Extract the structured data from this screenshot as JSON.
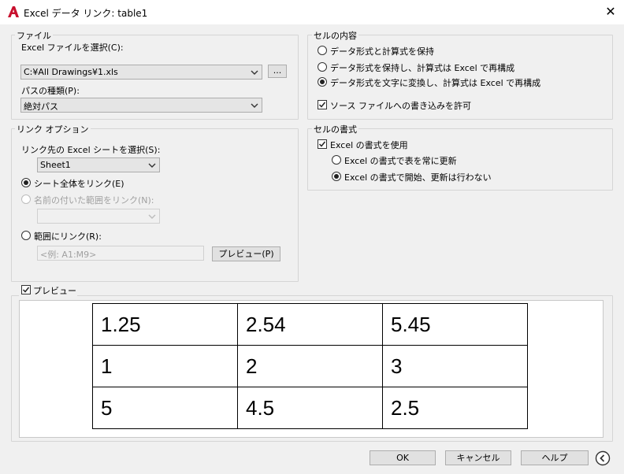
{
  "window": {
    "title": "Excel データ リンク: table1",
    "close": "✕"
  },
  "file_group": {
    "label": "ファイル",
    "select_label": "Excel ファイルを選択(C):",
    "file_value": "C:¥All Drawings¥1.xls",
    "browse_label": "...",
    "path_type_label": "パスの種類(P):",
    "path_type_value": "絶対パス"
  },
  "link_group": {
    "label": "リンク オプション",
    "sheet_select_label": "リンク先の Excel シートを選択(S):",
    "sheet_value": "Sheet1",
    "link_entire_sheet": "シート全体をリンク(E)",
    "link_named_range": "名前の付いた範囲をリンク(N):",
    "link_range": "範囲にリンク(R):",
    "range_placeholder": "<例: A1:M9>",
    "preview_button": "プレビュー(P)"
  },
  "cell_contents_group": {
    "label": "セルの内容",
    "option1": "データ形式と計算式を保持",
    "option2": "データ形式を保持し、計算式は Excel で再構成",
    "option3": "データ形式を文字に変換し、計算式は Excel で再構成",
    "allow_write": "ソース ファイルへの書き込みを許可"
  },
  "cell_format_group": {
    "label": "セルの書式",
    "use_excel_format": "Excel の書式を使用",
    "always_update": "Excel の書式で表を常に更新",
    "start_no_update": "Excel の書式で開始、更新は行わない"
  },
  "preview": {
    "label": "プレビュー",
    "rows": [
      [
        "1.25",
        "2.54",
        "5.45"
      ],
      [
        "1",
        "2",
        "3"
      ],
      [
        "5",
        "4.5",
        "2.5"
      ]
    ]
  },
  "buttons": {
    "ok": "OK",
    "cancel": "キャンセル",
    "help": "ヘルプ"
  },
  "colors": {
    "app_icon": "#c8102e"
  }
}
